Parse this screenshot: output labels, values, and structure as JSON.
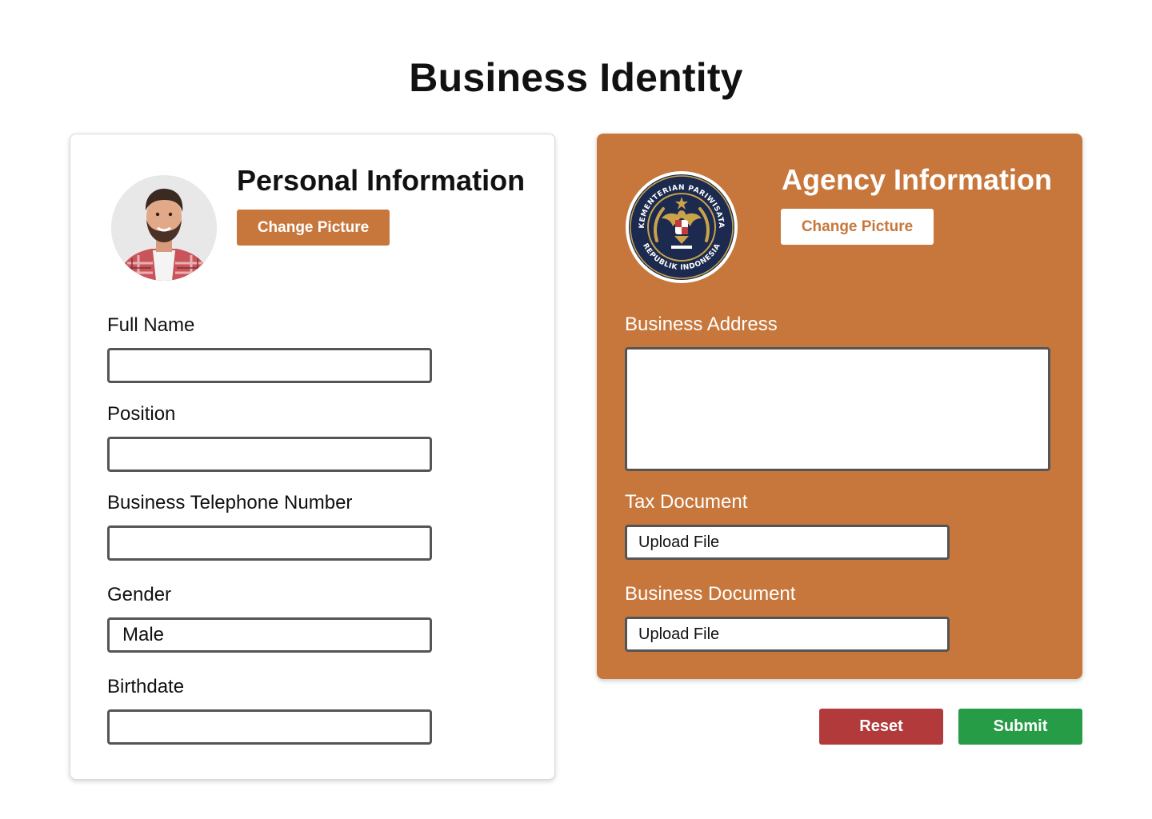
{
  "page": {
    "title": "Business Identity"
  },
  "personal": {
    "title": "Personal Information",
    "change_picture_label": "Change Picture",
    "fields": {
      "full_name": {
        "label": "Full Name",
        "value": ""
      },
      "position": {
        "label": "Position",
        "value": ""
      },
      "telephone": {
        "label": "Business Telephone Number",
        "value": ""
      },
      "gender": {
        "label": "Gender",
        "value": "Male"
      },
      "birthdate": {
        "label": "Birthdate",
        "value": ""
      }
    }
  },
  "agency": {
    "title": "Agency Information",
    "change_picture_label": "Change Picture",
    "emblem": {
      "top_text": "KEMENTERIAN PARIWISATA",
      "bottom_text": "REPUBLIK INDONESIA"
    },
    "fields": {
      "business_address": {
        "label": "Business Address",
        "value": ""
      },
      "tax_document": {
        "label": "Tax Document",
        "upload_label": "Upload File"
      },
      "business_document": {
        "label": "Business Document",
        "upload_label": "Upload File"
      }
    }
  },
  "actions": {
    "reset_label": "Reset",
    "submit_label": "Submit"
  },
  "colors": {
    "accent": "#c7773b",
    "reset": "#b33a3a",
    "submit": "#259c45",
    "input_border": "#555555"
  },
  "icons": {
    "avatar": "person-photo-avatar",
    "emblem": "garuda-emblem-logo"
  }
}
